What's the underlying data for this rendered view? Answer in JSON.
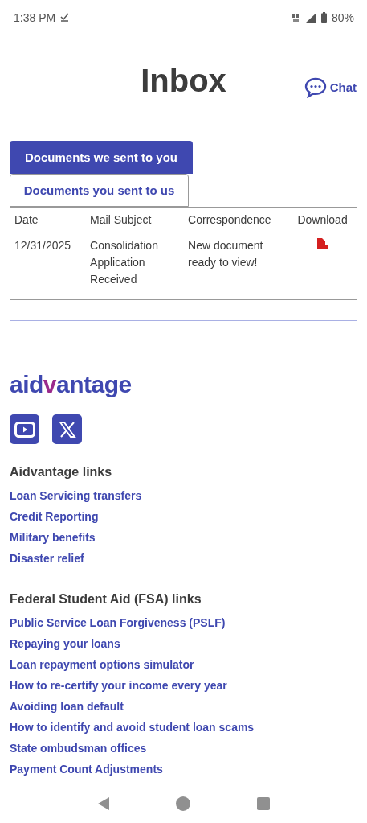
{
  "status_bar": {
    "time": "1:38 PM",
    "battery": "80%"
  },
  "header": {
    "title": "Inbox",
    "chat": "Chat"
  },
  "tabs": [
    {
      "label": "Documents we sent to you",
      "selected": true
    },
    {
      "label": "Documents you sent to us",
      "selected": false
    }
  ],
  "table": {
    "columns": [
      "Date",
      "Mail Subject",
      "Correspondence",
      "Download"
    ],
    "rows": [
      {
        "date": "12/31/2025",
        "subject": "Consolidation Application Received",
        "correspondence": "New document ready to view!"
      }
    ]
  },
  "footer": {
    "logo": [
      {
        "text": "aid",
        "accent": false
      },
      {
        "text": "v",
        "accent": true
      },
      {
        "text": "antage",
        "accent": false
      }
    ],
    "sections": [
      {
        "heading": "Aidvantage links",
        "links": [
          "Loan Servicing transfers",
          "Credit Reporting",
          "Military benefits",
          "Disaster relief"
        ]
      },
      {
        "heading": "Federal Student Aid (FSA) links",
        "links": [
          "Public Service Loan Forgiveness (PSLF)",
          "Repaying your loans",
          "Loan repayment options simulator",
          "How to re-certify your income every year",
          "Avoiding loan default",
          "How to identify and avoid student loan scams",
          "State ombudsman offices",
          "Payment Count Adjustments"
        ]
      }
    ]
  }
}
